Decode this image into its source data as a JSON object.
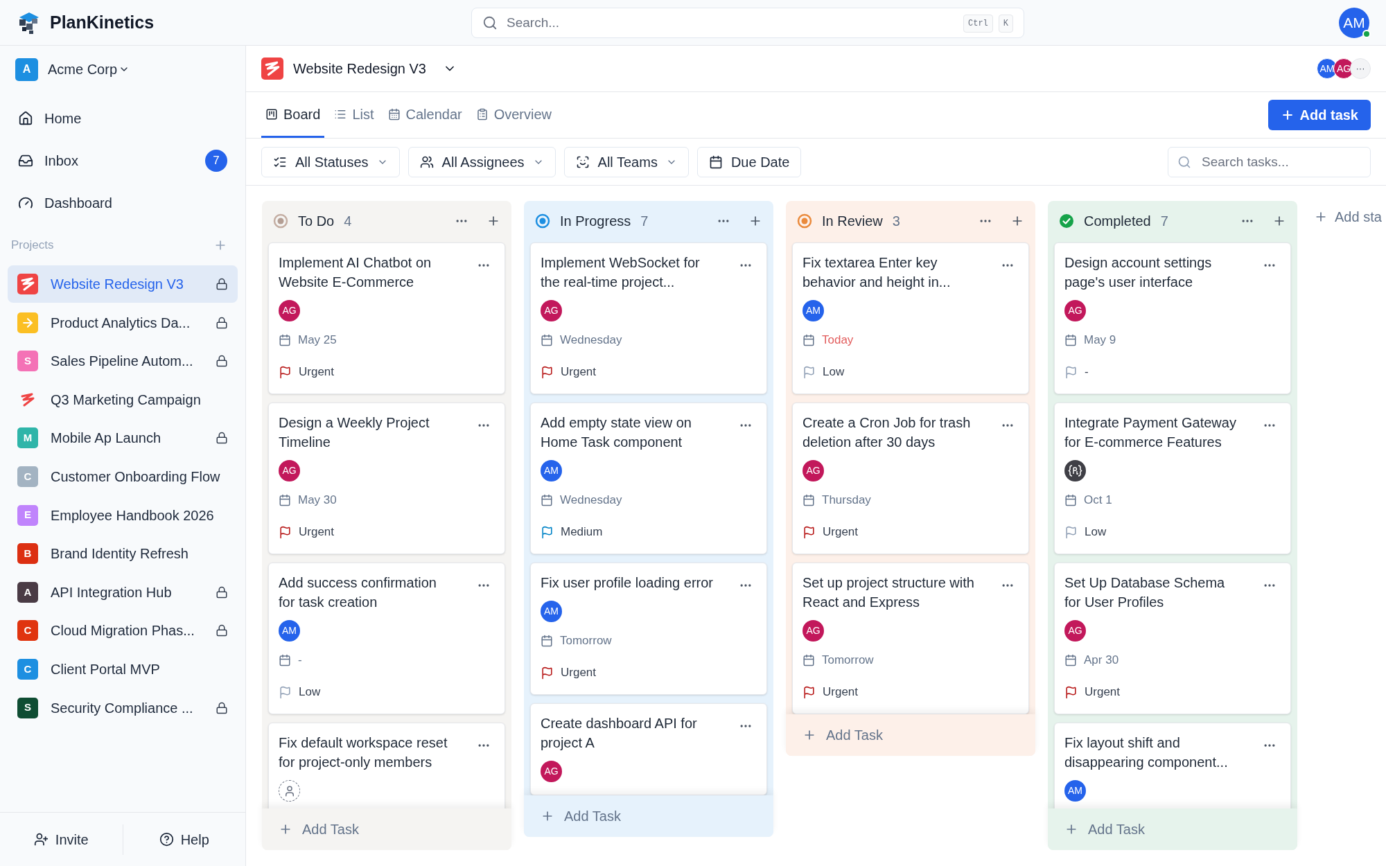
{
  "app": {
    "name": "PlanKinetics"
  },
  "top_search": {
    "placeholder": "Search...",
    "shortcut": [
      "Ctrl",
      "K"
    ]
  },
  "user": {
    "initials": "AM",
    "online": true
  },
  "sidebar": {
    "workspace": {
      "initial": "A",
      "name": "Acme Corp"
    },
    "nav": [
      {
        "label": "Home",
        "kind": "home"
      },
      {
        "label": "Inbox",
        "kind": "inbox",
        "badge": "7"
      },
      {
        "label": "Dashboard",
        "kind": "dashboard"
      }
    ],
    "projects_label": "Projects",
    "projects": [
      {
        "name": "Website Redesign V3",
        "kind": "squiggle-tile",
        "color": "#ef4444",
        "locked": true,
        "selected": true
      },
      {
        "name": "Product Analytics Da...",
        "kind": "arrow",
        "color": "#fbbf24",
        "locked": true,
        "selected": false
      },
      {
        "name": "Sales Pipeline Autom...",
        "kind": "letter",
        "letter": "S",
        "color": "#f472b6",
        "locked": true,
        "selected": false
      },
      {
        "name": "Q3 Marketing Campaign",
        "kind": "squiggle",
        "color": "#ef4444",
        "locked": false,
        "selected": false
      },
      {
        "name": "Mobile Ap Launch",
        "kind": "letter",
        "letter": "M",
        "color": "#2fb5a9",
        "locked": true,
        "selected": false
      },
      {
        "name": "Customer Onboarding Flow",
        "kind": "letter",
        "letter": "C",
        "color": "#a3b3c2",
        "locked": false,
        "selected": false
      },
      {
        "name": "Employee Handbook 2026",
        "kind": "letter",
        "letter": "E",
        "color": "#c084fc",
        "locked": false,
        "selected": false
      },
      {
        "name": "Brand Identity Refresh",
        "kind": "letter",
        "letter": "B",
        "color": "#dc2f12",
        "locked": false,
        "selected": false
      },
      {
        "name": "API Integration Hub",
        "kind": "letter",
        "letter": "A",
        "color": "#4a3b45",
        "locked": true,
        "selected": false
      },
      {
        "name": "Cloud Migration Phas...",
        "kind": "letter",
        "letter": "C",
        "color": "#e0340f",
        "locked": true,
        "selected": false
      },
      {
        "name": "Client Portal MVP",
        "kind": "letter",
        "letter": "C",
        "color": "#1d8fe1",
        "locked": false,
        "selected": false
      },
      {
        "name": "Security Compliance ...",
        "kind": "letter",
        "letter": "S",
        "color": "#0f4d33",
        "locked": true,
        "selected": false
      }
    ],
    "footer": [
      {
        "label": "Invite",
        "kind": "invite"
      },
      {
        "label": "Help",
        "kind": "help"
      }
    ]
  },
  "project": {
    "title": "Website Redesign V3",
    "members": [
      {
        "initials": "AM",
        "color": "#2563eb"
      },
      {
        "initials": "AG",
        "color": "#c2185b"
      }
    ],
    "more": "···"
  },
  "tabs": [
    {
      "label": "Board",
      "kind": "board",
      "selected": true
    },
    {
      "label": "List",
      "kind": "list",
      "selected": false
    },
    {
      "label": "Calendar",
      "kind": "calendar",
      "selected": false
    },
    {
      "label": "Overview",
      "kind": "overview",
      "selected": false
    }
  ],
  "add_task_button": "Add task",
  "filters": [
    {
      "label": "All Statuses",
      "kind": "statuses",
      "dropdown": true
    },
    {
      "label": "All Assignees",
      "kind": "assignees",
      "dropdown": true
    },
    {
      "label": "All Teams",
      "kind": "teams",
      "dropdown": true
    },
    {
      "label": "Due Date",
      "kind": "date",
      "dropdown": false
    }
  ],
  "task_search": {
    "placeholder": "Search tasks..."
  },
  "columns": [
    {
      "title": "To Do",
      "count": "4",
      "kind": "todo",
      "add_label": "Add Task",
      "cards": [
        {
          "title": "Implement AI Chatbot on Website E-Commerce",
          "assignee": {
            "kind": "initials",
            "initials": "AG",
            "color": "#c2185b"
          },
          "due": "May 25",
          "due_today": false,
          "priority": {
            "label": "Urgent",
            "kind": "urgent"
          }
        },
        {
          "title": "Design a Weekly Project Timeline",
          "assignee": {
            "kind": "initials",
            "initials": "AG",
            "color": "#c2185b"
          },
          "due": "May 30",
          "due_today": false,
          "priority": {
            "label": "Urgent",
            "kind": "urgent"
          }
        },
        {
          "title": "Add success confirmation for task creation",
          "assignee": {
            "kind": "initials",
            "initials": "AM",
            "color": "#2563eb"
          },
          "due": "-",
          "due_today": false,
          "priority": {
            "label": "Low",
            "kind": "low"
          }
        },
        {
          "title": "Fix default workspace reset for project-only members",
          "assignee": {
            "kind": "none"
          }
        }
      ]
    },
    {
      "title": "In Progress",
      "count": "7",
      "kind": "progress",
      "add_label": "Add Task",
      "cards": [
        {
          "title": "Implement WebSocket for the real-time project...",
          "assignee": {
            "kind": "initials",
            "initials": "AG",
            "color": "#c2185b"
          },
          "due": "Wednesday",
          "due_today": false,
          "priority": {
            "label": "Urgent",
            "kind": "urgent"
          }
        },
        {
          "title": "Add empty state view on Home Task component",
          "assignee": {
            "kind": "initials",
            "initials": "AM",
            "color": "#2563eb"
          },
          "due": "Wednesday",
          "due_today": false,
          "priority": {
            "label": "Medium",
            "kind": "medium"
          }
        },
        {
          "title": "Fix user profile loading error",
          "assignee": {
            "kind": "initials",
            "initials": "AM",
            "color": "#2563eb"
          },
          "due": "Tomorrow",
          "due_today": false,
          "priority": {
            "label": "Urgent",
            "kind": "urgent"
          }
        },
        {
          "title": "Create dashboard API for project A",
          "assignee": {
            "kind": "initials",
            "initials": "AG",
            "color": "#c2185b"
          }
        }
      ]
    },
    {
      "title": "In Review",
      "count": "3",
      "kind": "review",
      "add_label": "Add Task",
      "cards": [
        {
          "title": "Fix textarea Enter key behavior and height in...",
          "assignee": {
            "kind": "initials",
            "initials": "AM",
            "color": "#2563eb"
          },
          "due": "Today",
          "due_today": true,
          "priority": {
            "label": "Low",
            "kind": "low"
          }
        },
        {
          "title": "Create a Cron Job for trash deletion after 30 days",
          "assignee": {
            "kind": "initials",
            "initials": "AG",
            "color": "#c2185b"
          },
          "due": "Thursday",
          "due_today": false,
          "priority": {
            "label": "Urgent",
            "kind": "urgent"
          }
        },
        {
          "title": "Set up project structure with React and Express",
          "assignee": {
            "kind": "initials",
            "initials": "AG",
            "color": "#c2185b"
          },
          "due": "Tomorrow",
          "due_today": false,
          "priority": {
            "label": "Urgent",
            "kind": "urgent"
          }
        }
      ]
    },
    {
      "title": "Completed",
      "count": "7",
      "kind": "done",
      "add_label": "Add Task",
      "cards": [
        {
          "title": "Design account settings page's user interface",
          "assignee": {
            "kind": "initials",
            "initials": "AG",
            "color": "#c2185b"
          },
          "due": "May 9",
          "due_today": false,
          "priority": {
            "label": "-",
            "kind": "none"
          }
        },
        {
          "title": "Integrate Payment Gateway for E-commerce Features",
          "assignee": {
            "kind": "logo"
          },
          "due": "Oct 1",
          "due_today": false,
          "priority": {
            "label": "Low",
            "kind": "low"
          }
        },
        {
          "title": "Set Up Database Schema for User Profiles",
          "assignee": {
            "kind": "initials",
            "initials": "AG",
            "color": "#c2185b"
          },
          "due": "Apr 30",
          "due_today": false,
          "priority": {
            "label": "Urgent",
            "kind": "urgent"
          }
        },
        {
          "title": "Fix layout shift and disappearing component...",
          "assignee": {
            "kind": "initials",
            "initials": "AM",
            "color": "#2563eb"
          }
        }
      ]
    }
  ],
  "add_status": "Add sta"
}
